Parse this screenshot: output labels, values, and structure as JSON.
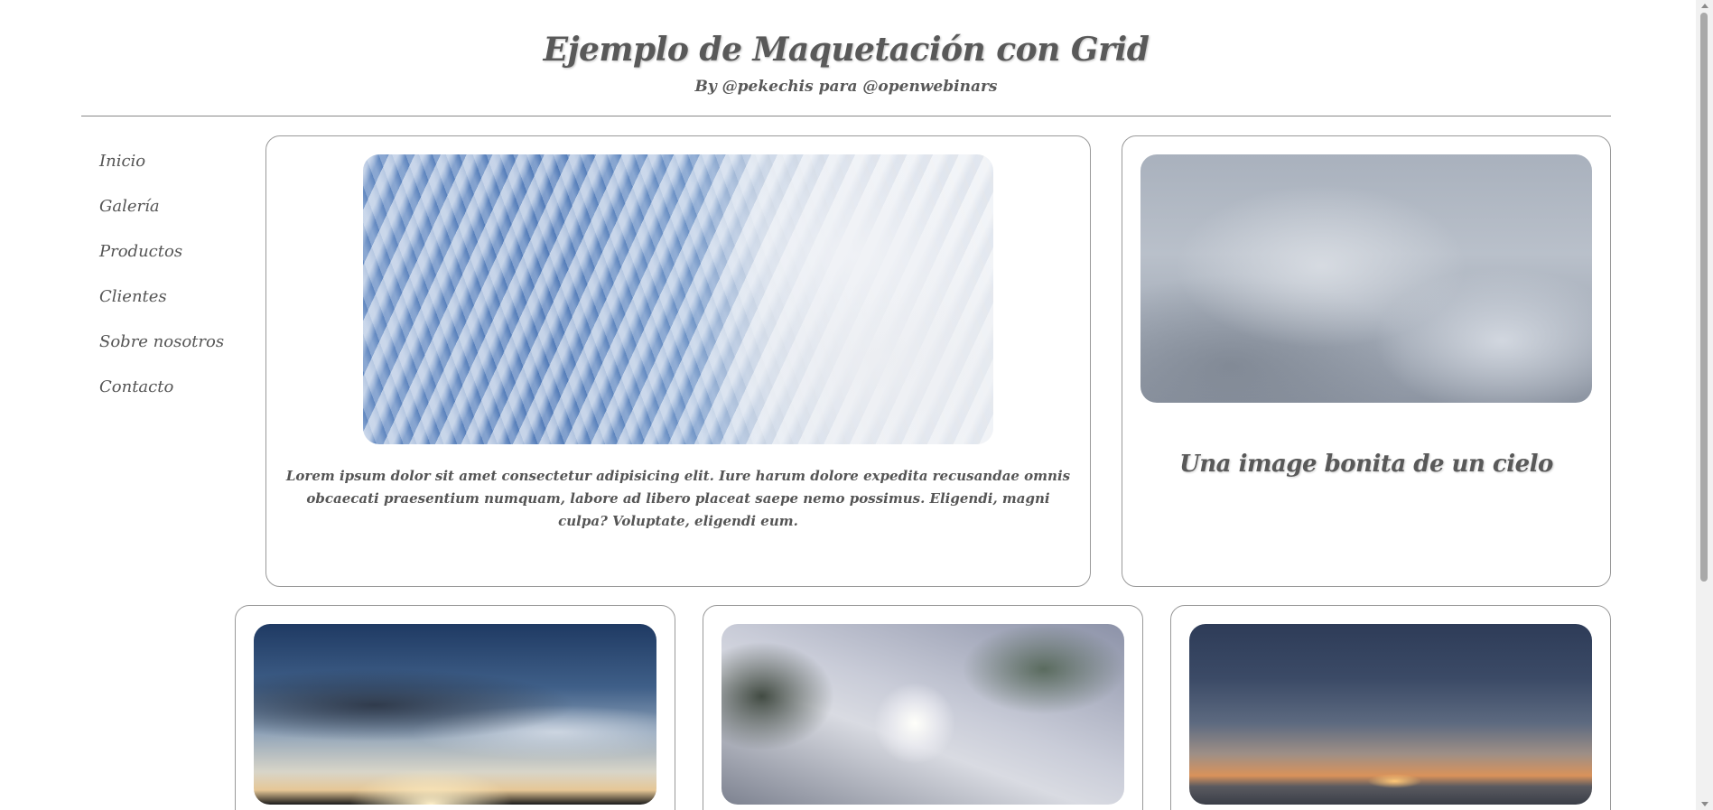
{
  "header": {
    "title": "Ejemplo de Maquetación con Grid",
    "subtitle": "By @pekechis para @openwebinars"
  },
  "nav": {
    "items": [
      {
        "label": "Inicio"
      },
      {
        "label": "Galería"
      },
      {
        "label": "Productos"
      },
      {
        "label": "Clientes"
      },
      {
        "label": "Sobre nosotros"
      },
      {
        "label": "Contacto"
      }
    ]
  },
  "main_card": {
    "text": "Lorem ipsum dolor sit amet consectetur adipisicing elit. Iure harum dolore expedita recusandae omnis obcaecati praesentium numquam, labore ad libero placeat saepe nemo possimus. Eligendi, magni culpa? Voluptate, eligendi eum."
  },
  "side_card": {
    "title": "Una image bonita de un cielo"
  },
  "colors": {
    "text": "#555555",
    "border": "#999999",
    "header_rule": "#888888"
  }
}
